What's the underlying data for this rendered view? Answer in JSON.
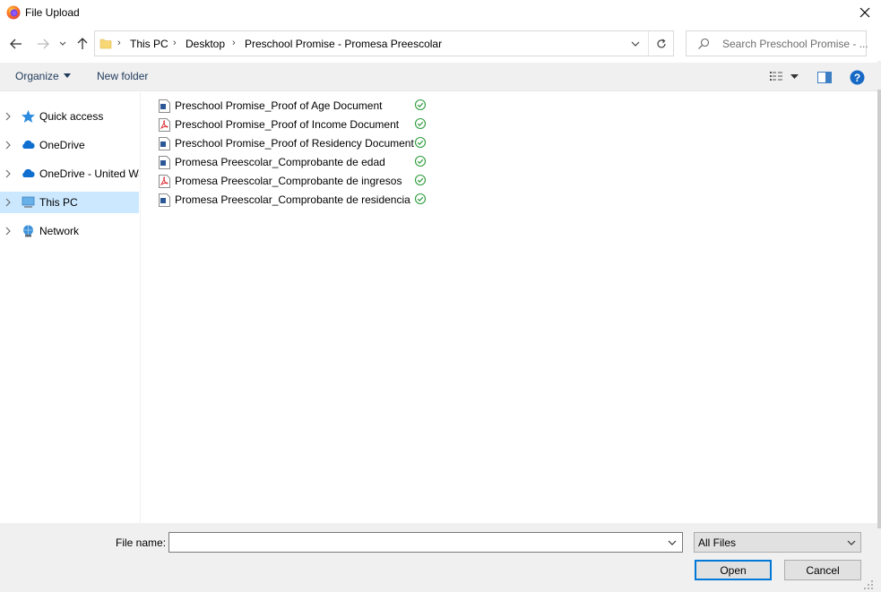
{
  "window": {
    "title": "File Upload"
  },
  "address": {
    "crumbs": [
      "This PC",
      "Desktop",
      "Preschool Promise  - Promesa Preescolar"
    ]
  },
  "search": {
    "placeholder": "Search Preschool Promise  - ..."
  },
  "toolbar": {
    "organize_label": "Organize",
    "new_folder_label": "New folder"
  },
  "sidebar": {
    "items": [
      {
        "label": "Quick access",
        "icon": "star-icon"
      },
      {
        "label": "OneDrive",
        "icon": "cloud-icon"
      },
      {
        "label": "OneDrive - United Way",
        "icon": "cloud-icon"
      },
      {
        "label": "This PC",
        "icon": "computer-icon",
        "selected": true
      },
      {
        "label": "Network",
        "icon": "network-icon"
      }
    ]
  },
  "files": [
    {
      "name": "Preschool Promise_Proof of Age Document",
      "type": "word",
      "status": "synced"
    },
    {
      "name": "Preschool Promise_Proof of Income Document",
      "type": "pdf",
      "status": "synced"
    },
    {
      "name": "Preschool Promise_Proof of Residency Document",
      "type": "word",
      "status": "synced"
    },
    {
      "name": "Promesa Preescolar_Comprobante de edad",
      "type": "word",
      "status": "synced"
    },
    {
      "name": "Promesa Preescolar_Comprobante de ingresos",
      "type": "pdf",
      "status": "synced"
    },
    {
      "name": "Promesa Preescolar_Comprobante de residencia",
      "type": "word",
      "status": "synced"
    }
  ],
  "footer": {
    "file_name_label": "File name:",
    "file_name_value": "",
    "file_type_selected": "All Files",
    "open_label": "Open",
    "cancel_label": "Cancel"
  },
  "colors": {
    "selection": "#cce8ff",
    "accent": "#0078d7",
    "sync_green": "#2d9c3c",
    "help_blue": "#1668c5"
  }
}
